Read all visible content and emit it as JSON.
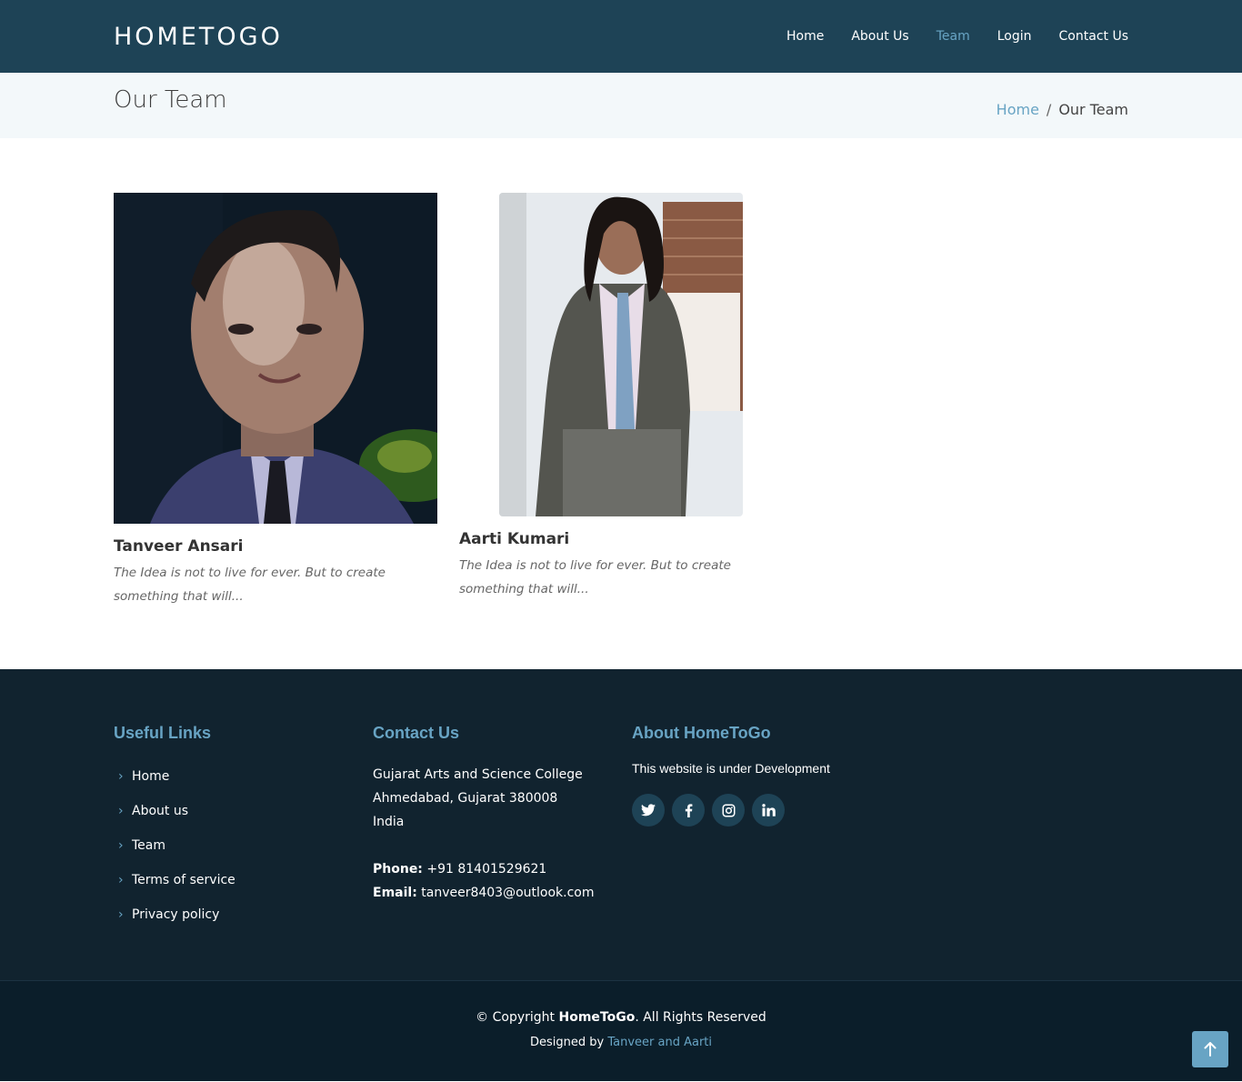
{
  "header": {
    "logo": "HOMETOGO",
    "nav": [
      "Home",
      "About Us",
      "Team",
      "Login",
      "Contact Us"
    ],
    "active_nav": "Team"
  },
  "breadcrumb": {
    "title": "Our Team",
    "home": "Home",
    "separator": "/",
    "current": "Our Team"
  },
  "team": [
    {
      "name": "Tanveer Ansari",
      "quote": "The Idea is not to live for ever. But to create something that will..."
    },
    {
      "name": "Aarti Kumari",
      "quote": "The Idea is not to live for ever. But to create something that will..."
    }
  ],
  "footer": {
    "useful_links": {
      "title": "Useful Links",
      "items": [
        "Home",
        "About us",
        "Team",
        "Terms of service",
        "Privacy policy"
      ]
    },
    "contact": {
      "title": "Contact Us",
      "address_line1": "Gujarat Arts and Science College",
      "address_line2": "Ahmedabad, Gujarat 380008",
      "address_line3": "India",
      "phone_label": "Phone:",
      "phone": "+91 81401529621",
      "email_label": "Email:",
      "email": "tanveer8403@outlook.com"
    },
    "about": {
      "title": "About HomeToGo",
      "text": "This website is under Development",
      "social_icons": [
        "twitter-icon",
        "facebook-icon",
        "instagram-icon",
        "linkedin-icon"
      ]
    },
    "copyright_prefix": "© Copyright",
    "copyright_brand": "HomeToGo",
    "copyright_suffix": ". All Rights Reserved",
    "designed_by": "Designed by",
    "designers": "Tanveer and Aarti"
  },
  "colors": {
    "header_bg": "#1e4356",
    "accent": "#68a4c4",
    "footer_bg": "#11232f",
    "footer_bottom_bg": "#0b1e2a"
  }
}
